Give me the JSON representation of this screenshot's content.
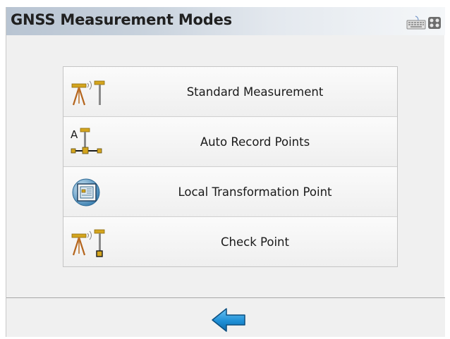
{
  "window": {
    "title": "GNSS Measurement Modes"
  },
  "system_icons": [
    "keyboard-icon",
    "gamepad-icon"
  ],
  "modes": [
    {
      "label": "Standard Measurement",
      "icon": "tripod-antenna-icon"
    },
    {
      "label": "Auto Record Points",
      "icon": "auto-record-icon"
    },
    {
      "label": "Local Transformation Point",
      "icon": "transformation-icon"
    },
    {
      "label": "Check Point",
      "icon": "check-point-icon"
    }
  ],
  "footer": {
    "back_icon": "back-arrow-icon"
  },
  "colors": {
    "accent_blue": "#1e8fd6",
    "gold": "#d4a51e"
  }
}
